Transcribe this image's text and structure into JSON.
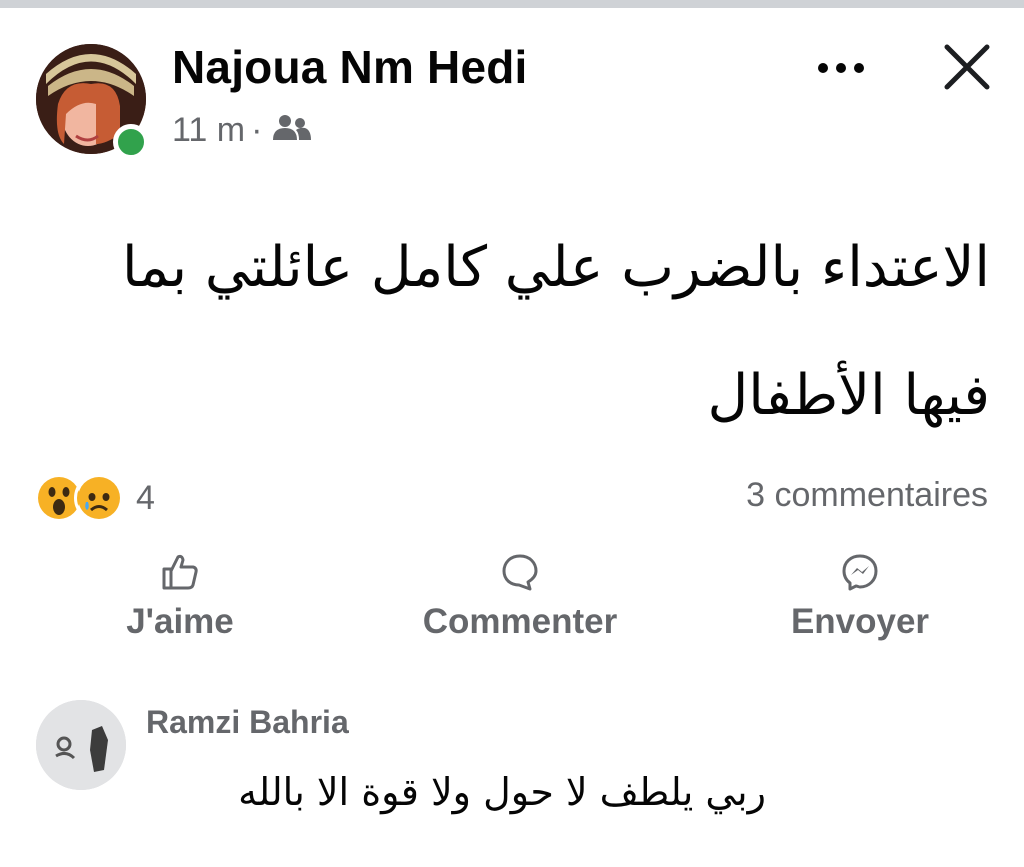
{
  "post": {
    "author": {
      "name": "Najoua Nm Hedi",
      "online": true
    },
    "time": "11 m",
    "separator": "·",
    "audience_icon": "friends-icon",
    "more_icon": "more-horizontal-icon",
    "close_icon": "close-icon",
    "text_line1": "الاعتداء بالضرب علي كامل عائلتي بما",
    "text_line2": "فيها الأطفال"
  },
  "reactions": {
    "icons": [
      "wow-reaction-icon",
      "sad-reaction-icon"
    ],
    "count": "4"
  },
  "comments_count_label": "3 commentaires",
  "actions": {
    "like": {
      "label": "J'aime",
      "icon": "thumbs-up-icon"
    },
    "comment": {
      "label": "Commenter",
      "icon": "comment-bubble-icon"
    },
    "send": {
      "label": "Envoyer",
      "icon": "messenger-icon"
    }
  },
  "comment": {
    "author": "Ramzi Bahria",
    "text": "ربي يلطف لا حول ولا قوة الا بالله"
  },
  "colors": {
    "secondary_text": "#65676b",
    "primary_text": "#050505",
    "online_green": "#31a24c",
    "reaction_yellow": "#f7b125"
  }
}
